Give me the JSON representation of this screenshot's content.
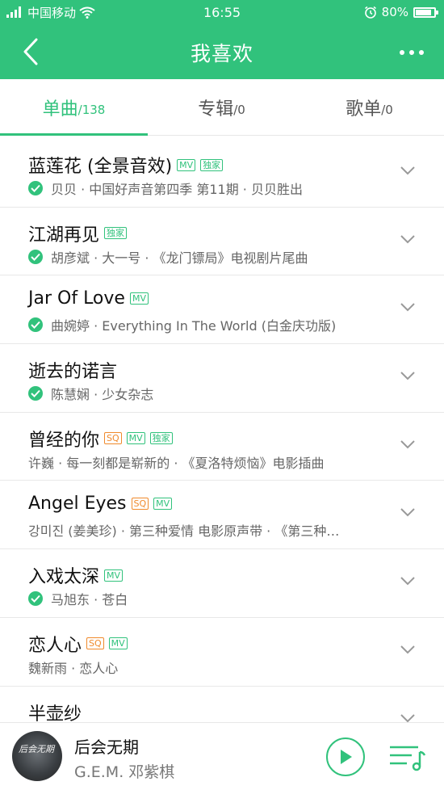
{
  "status": {
    "carrier": "中国移动",
    "time": "16:55",
    "battery": "80%",
    "battery_level": 0.8
  },
  "header": {
    "title": "我喜欢"
  },
  "tabs": [
    {
      "label": "单曲",
      "count": "/138",
      "active": true
    },
    {
      "label": "专辑",
      "count": "/0",
      "active": false
    },
    {
      "label": "歌单",
      "count": "/0",
      "active": false
    }
  ],
  "songs": [
    {
      "title": "蓝莲花 (全景音效)",
      "badges": [
        "MV",
        "独家"
      ],
      "downloaded": true,
      "subtitle": "贝贝 · 中国好声音第四季 第11期 · 贝贝胜出"
    },
    {
      "title": "江湖再见",
      "badges": [
        "独家"
      ],
      "downloaded": true,
      "subtitle": "胡彦斌 · 大一号 · 《龙门镖局》电视剧片尾曲"
    },
    {
      "title": "Jar Of Love",
      "badges": [
        "MV"
      ],
      "downloaded": true,
      "subtitle": "曲婉婷 · Everything In The World (白金庆功版)"
    },
    {
      "title": "逝去的诺言",
      "badges": [],
      "downloaded": true,
      "subtitle": "陈慧娴 · 少女杂志"
    },
    {
      "title": "曾经的你",
      "badges": [
        "SQ",
        "MV",
        "独家"
      ],
      "downloaded": false,
      "subtitle": "许巍 · 每一刻都是崭新的 · 《夏洛特烦恼》电影插曲"
    },
    {
      "title": "Angel Eyes",
      "badges": [
        "SQ",
        "MV"
      ],
      "downloaded": false,
      "subtitle": "강미진 (姜美珍) · 第三种爱情 电影原声带 · 《第三种…"
    },
    {
      "title": "入戏太深",
      "badges": [
        "MV"
      ],
      "downloaded": true,
      "subtitle": "马旭东 · 苍白"
    },
    {
      "title": "恋人心",
      "badges": [
        "SQ",
        "MV"
      ],
      "downloaded": false,
      "subtitle": "魏新雨 · 恋人心"
    },
    {
      "title": "半壶纱",
      "badges": [],
      "downloaded": false,
      "subtitle": ""
    }
  ],
  "player": {
    "title": "后会无期",
    "artist": "G.E.M. 邓紫棋",
    "cover_text": "后会无期"
  },
  "colors": {
    "accent": "#31c27c",
    "sq": "#f08a2c"
  }
}
